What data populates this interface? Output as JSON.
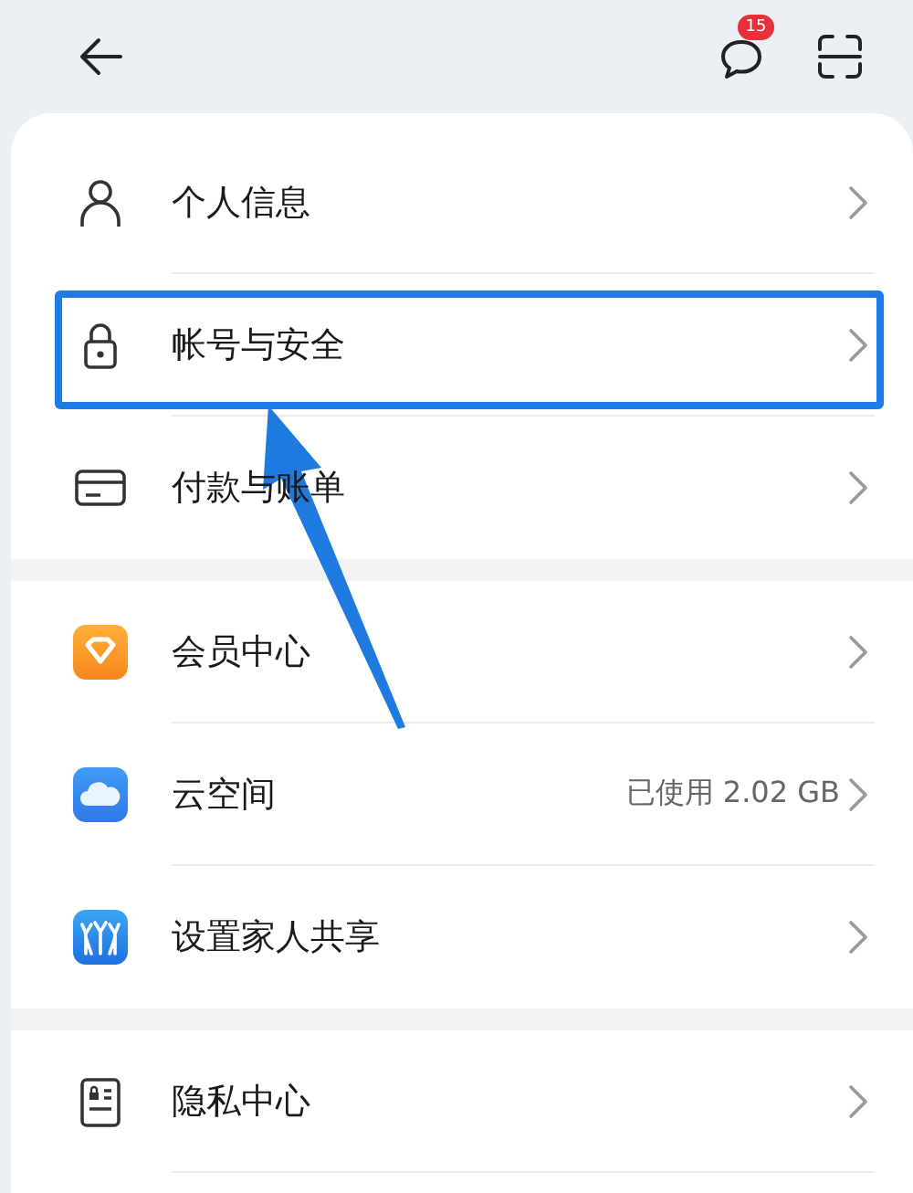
{
  "top_bar": {
    "badge": "15"
  },
  "groups": [
    {
      "items": [
        {
          "kind": "person",
          "label": "个人信息",
          "highlighted": false
        },
        {
          "kind": "lock",
          "label": "帐号与安全",
          "highlighted": true
        },
        {
          "kind": "card",
          "label": "付款与账单",
          "highlighted": false
        }
      ]
    },
    {
      "items": [
        {
          "kind": "vip",
          "label": "会员中心",
          "highlighted": false
        },
        {
          "kind": "cloud",
          "label": "云空间",
          "value": "已使用 2.02 GB",
          "highlighted": false
        },
        {
          "kind": "family",
          "label": "设置家人共享",
          "highlighted": false
        }
      ]
    },
    {
      "items": [
        {
          "kind": "privacy",
          "label": "隐私中心",
          "highlighted": false
        }
      ]
    }
  ]
}
